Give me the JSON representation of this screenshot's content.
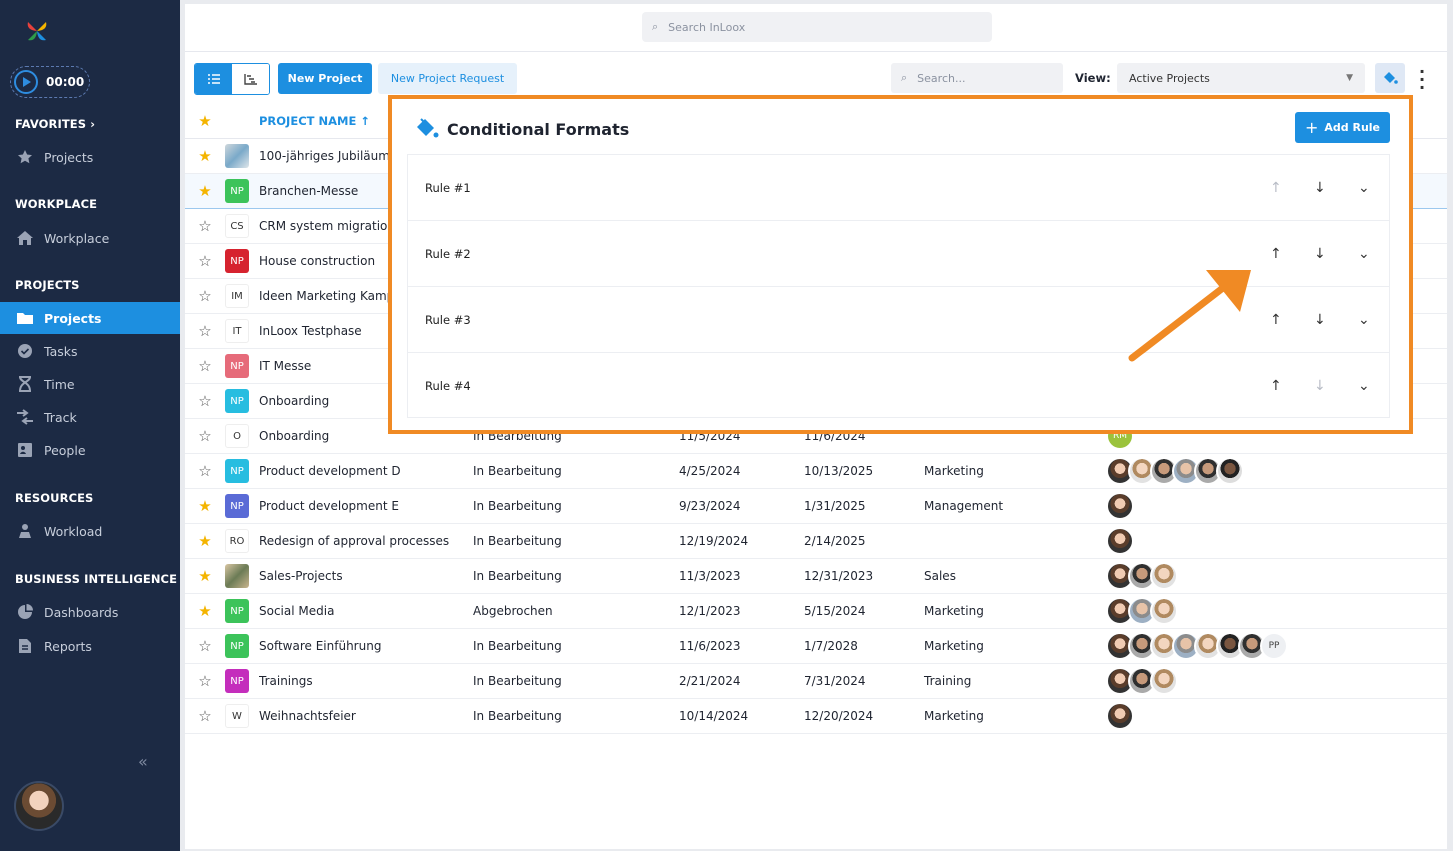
{
  "sidebar": {
    "timer": "00:00",
    "favorites_label": "FAVORITES",
    "favorites_items": [
      "Projects"
    ],
    "workplace_label": "WORKPLACE",
    "workplace_items": [
      "Workplace"
    ],
    "projects_label": "PROJECTS",
    "projects_items": [
      "Projects",
      "Tasks",
      "Time",
      "Track",
      "People"
    ],
    "resources_label": "RESOURCES",
    "resources_items": [
      "Workload"
    ],
    "bi_label": "BUSINESS INTELLIGENCE",
    "bi_items": [
      "Dashboards",
      "Reports"
    ]
  },
  "topbar": {
    "search_placeholder": "Search InLoox"
  },
  "toolbar": {
    "new_project": "New Project",
    "new_project_request": "New Project Request",
    "search_placeholder": "Search...",
    "view_label": "View:",
    "view_value": "Active Projects"
  },
  "table": {
    "header_name": "PROJECT NAME",
    "rows": [
      {
        "fav": true,
        "badge": "",
        "name": "100-jähriges Jubiläum"
      },
      {
        "fav": true,
        "badge": "NP",
        "name": "Branchen-Messe"
      },
      {
        "fav": false,
        "badge": "CS",
        "name": "CRM system migration"
      },
      {
        "fav": false,
        "badge": "NP",
        "name": "House construction"
      },
      {
        "fav": false,
        "badge": "IM",
        "name": "Ideen Marketing Kampagne"
      },
      {
        "fav": false,
        "badge": "IT",
        "name": "InLoox Testphase"
      },
      {
        "fav": false,
        "badge": "NP",
        "name": "IT Messe"
      },
      {
        "fav": false,
        "badge": "NP",
        "name": "Onboarding"
      },
      {
        "fav": false,
        "badge": "O",
        "name": "Onboarding",
        "status": "In Bearbeitung",
        "start": "11/5/2024",
        "end": "11/6/2024",
        "people_badge": "RM"
      },
      {
        "fav": false,
        "badge": "NP",
        "name": "Product development D",
        "status": "In Bearbeitung",
        "start": "4/25/2024",
        "end": "10/13/2025",
        "dept": "Marketing"
      },
      {
        "fav": true,
        "badge": "NP",
        "name": "Product development E",
        "status": "In Bearbeitung",
        "start": "9/23/2024",
        "end": "1/31/2025",
        "dept": "Management"
      },
      {
        "fav": true,
        "badge": "RO",
        "name": "Redesign of approval processes",
        "status": "In Bearbeitung",
        "start": "12/19/2024",
        "end": "2/14/2025",
        "dept": ""
      },
      {
        "fav": true,
        "badge": "",
        "name": "Sales-Projects",
        "status": "In Bearbeitung",
        "start": "11/3/2023",
        "end": "12/31/2023",
        "dept": "Sales"
      },
      {
        "fav": true,
        "badge": "NP",
        "name": "Social Media",
        "status": "Abgebrochen",
        "start": "12/1/2023",
        "end": "5/15/2024",
        "dept": "Marketing"
      },
      {
        "fav": false,
        "badge": "NP",
        "name": "Software Einführung",
        "status": "In Bearbeitung",
        "start": "11/6/2023",
        "end": "1/7/2028",
        "dept": "Marketing",
        "people_badge": "PP"
      },
      {
        "fav": false,
        "badge": "NP",
        "name": "Trainings",
        "status": "In Bearbeitung",
        "start": "2/21/2024",
        "end": "7/31/2024",
        "dept": "Training"
      },
      {
        "fav": false,
        "badge": "W",
        "name": "Weihnachtsfeier",
        "status": "In Bearbeitung",
        "start": "10/14/2024",
        "end": "12/20/2024",
        "dept": "Marketing"
      }
    ]
  },
  "panel": {
    "title": "Conditional Formats",
    "add_rule": "Add Rule",
    "rules": [
      "Rule #1",
      "Rule #2",
      "Rule #3",
      "Rule #4"
    ]
  },
  "colors": {
    "accent": "#1d8fe0",
    "sidebar": "#1c2a44",
    "highlight": "#f08a24"
  }
}
